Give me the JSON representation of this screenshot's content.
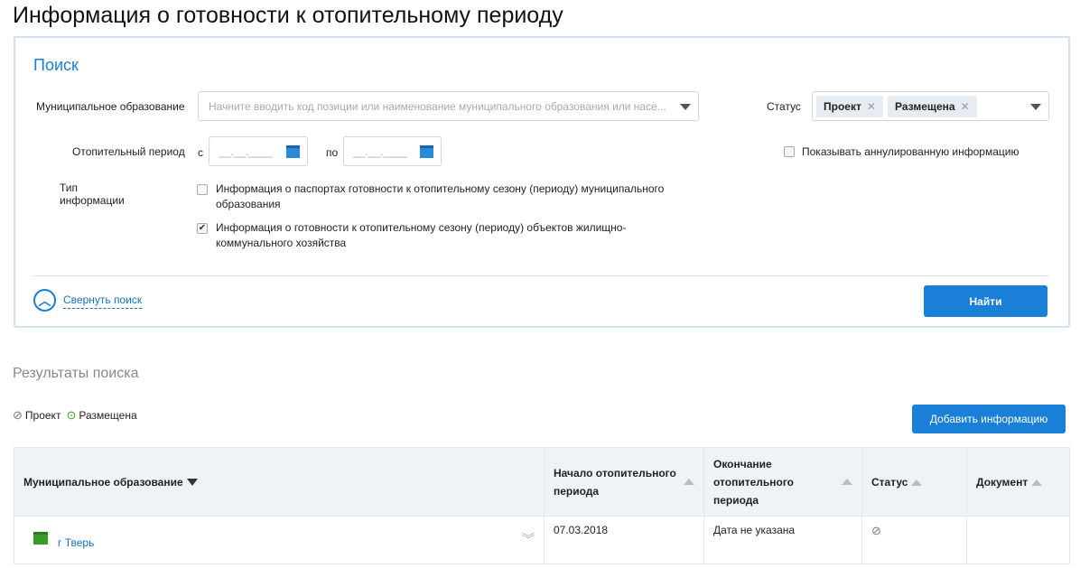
{
  "page_title": "Информация о готовности к отопительному периоду",
  "search": {
    "title": "Поиск",
    "municipality_label": "Муниципальное образование",
    "municipality_placeholder": "Начните вводить код позиции или наименование муниципального образования или насе...",
    "status_label": "Статус",
    "status_tags": [
      "Проект",
      "Размещена"
    ],
    "period_label": "Отопительный период",
    "from_label": "с",
    "to_label": "по",
    "date_mask": "__.__.____",
    "show_annulled": "Показывать аннулированную информацию",
    "info_type_label": "Тип информации",
    "info_types": [
      {
        "label": "Информация о паспортах готовности к отопительному сезону (периоду) муниципального образования",
        "checked": false
      },
      {
        "label": "Информация о готовности к отопительному сезону (периоду) объектов жилищно-коммунального хозяйства",
        "checked": true
      }
    ],
    "collapse_label": "Свернуть поиск",
    "find_button": "Найти"
  },
  "results": {
    "title": "Результаты поиска",
    "legend": {
      "draft": "Проект",
      "published": "Размещена"
    },
    "add_button": "Добавить информацию",
    "columns": [
      "Муниципальное образование",
      "Начало отопительного периода",
      "Окончание отопительного периода",
      "Статус",
      "Документ"
    ],
    "rows": [
      {
        "municipality": "г Тверь",
        "start": "07.03.2018",
        "end": "Дата не указана",
        "status": "draft",
        "document": ""
      }
    ]
  }
}
